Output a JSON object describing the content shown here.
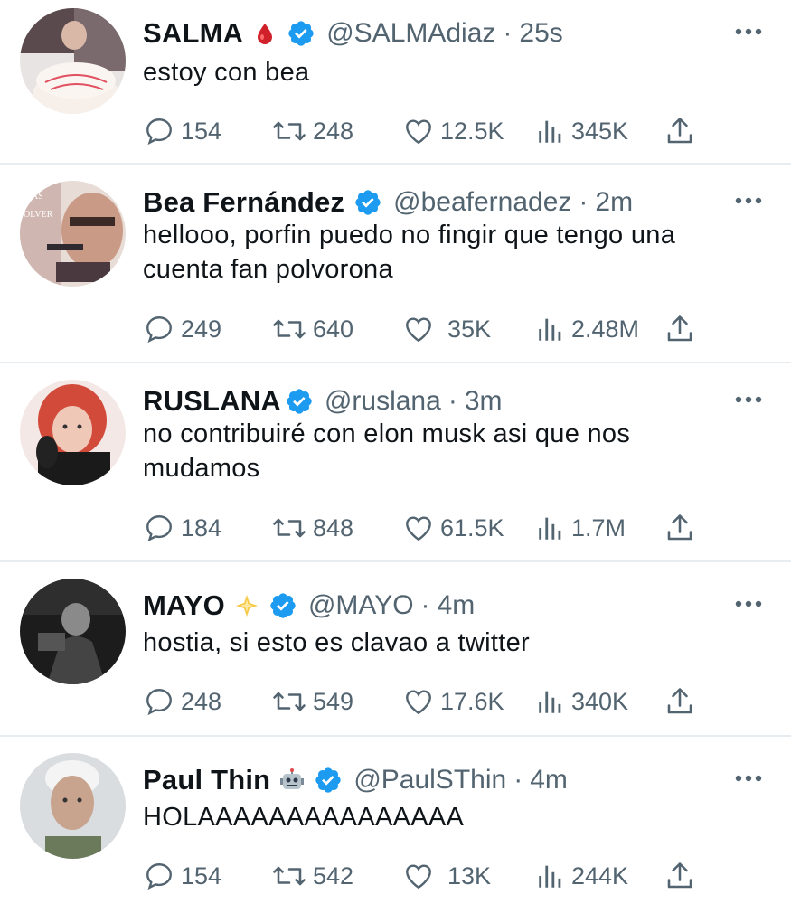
{
  "tweets": [
    {
      "name": "SALMA",
      "emoji": "drop-of-blood",
      "handle": "@SALMAdiaz",
      "separator": "·",
      "time": "25s",
      "text": [
        "estoy con bea"
      ],
      "replies": "154",
      "retweets": "248",
      "likes": "12.5K",
      "views": "345K"
    },
    {
      "name": "Bea Fernández",
      "emoji": "",
      "handle": "@beafernadez",
      "separator": "·",
      "time": "2m",
      "text": [
        "hellooo, porfin puedo no fingir que tengo una",
        "cuenta fan polvorona"
      ],
      "replies": "249",
      "retweets": "640",
      "likes": "35K",
      "views": "2.48M"
    },
    {
      "name": "RUSLANA",
      "emoji": "",
      "handle": "@ruslana",
      "separator": "·",
      "time": "3m",
      "text": [
        "no contribuiré con elon musk asi que nos",
        "mudamos"
      ],
      "replies": "184",
      "retweets": "848",
      "likes": "61.5K",
      "views": "1.7M"
    },
    {
      "name": "MAYO",
      "emoji": "glowing-star",
      "handle": "@MAYO",
      "separator": "·",
      "time": "4m",
      "text": [
        "hostia, si esto es clavao a twitter"
      ],
      "replies": "248",
      "retweets": "549",
      "likes": "17.6K",
      "views": "340K"
    },
    {
      "name": "Paul Thin",
      "emoji": "robot-face",
      "handle": "@PaulSThin",
      "separator": "·",
      "time": "4m",
      "text": [
        "HOLAAAAAAAAAAAAAAA"
      ],
      "replies": "154",
      "retweets": "542",
      "likes": "13K",
      "views": "244K"
    }
  ],
  "colors": {
    "verified": "#1d9bf0",
    "muted": "#536471",
    "text": "#0f1419",
    "divider": "#e6ecf0"
  }
}
